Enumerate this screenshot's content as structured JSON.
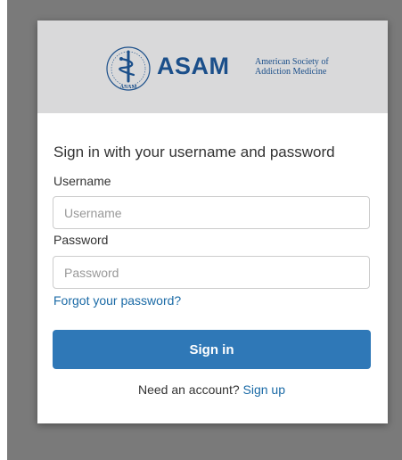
{
  "brand": {
    "name": "ASAM",
    "tagline_line1": "American Society of",
    "tagline_line2": "Addiction Medicine",
    "seal_text": "ASAM",
    "primary_color": "#1b4f8a"
  },
  "form": {
    "heading": "Sign in with your username and password",
    "username_label": "Username",
    "username_placeholder": "Username",
    "username_value": "",
    "password_label": "Password",
    "password_placeholder": "Password",
    "password_value": "",
    "forgot_link": "Forgot your password?",
    "submit_label": "Sign in",
    "submit_color": "#2f78b7"
  },
  "signup": {
    "prompt": "Need an account?",
    "link": "Sign up"
  },
  "icons": {
    "logo": "asam-seal-icon"
  }
}
